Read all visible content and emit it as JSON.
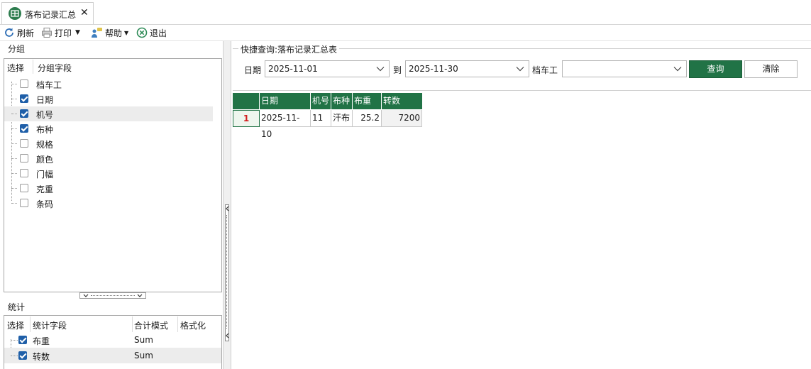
{
  "tab": {
    "title": "落布记录汇总",
    "close": "✕"
  },
  "toolbar": {
    "refresh": "刷新",
    "print": "打印",
    "help": "帮助",
    "exit": "退出"
  },
  "group_panel": {
    "title": "分组",
    "col_select": "选择",
    "col_field": "分组字段",
    "items": [
      {
        "label": "档车工",
        "checked": false
      },
      {
        "label": "日期",
        "checked": true
      },
      {
        "label": "机号",
        "checked": true
      },
      {
        "label": "布种",
        "checked": true
      },
      {
        "label": "规格",
        "checked": false
      },
      {
        "label": "颜色",
        "checked": false
      },
      {
        "label": "门幅",
        "checked": false
      },
      {
        "label": "克重",
        "checked": false
      },
      {
        "label": "条码",
        "checked": false
      }
    ]
  },
  "stats_panel": {
    "title": "统计",
    "col_select": "选择",
    "col_field": "统计字段",
    "col_mode": "合计模式",
    "col_format": "格式化",
    "items": [
      {
        "label": "布重",
        "mode": "Sum",
        "checked": true
      },
      {
        "label": "转数",
        "mode": "Sum",
        "checked": true
      }
    ]
  },
  "query": {
    "legend": "快捷查询:落布记录汇总表",
    "date_label": "日期",
    "date_from": "2025-11-01",
    "to_label": "到",
    "date_to": "2025-11-30",
    "operator_label": "档车工",
    "operator_value": "",
    "search_button": "查询",
    "clear_button": "清除"
  },
  "grid": {
    "headers": [
      "日期",
      "机号",
      "布种",
      "布重",
      "转数"
    ],
    "rows": [
      {
        "index": "1",
        "date": "2025-11-10",
        "machine": "11",
        "fabric": "汗布",
        "weight": "25.2",
        "turns": "7200"
      }
    ]
  },
  "colors": {
    "accent": "#217346",
    "check": "#1f5fa8"
  }
}
